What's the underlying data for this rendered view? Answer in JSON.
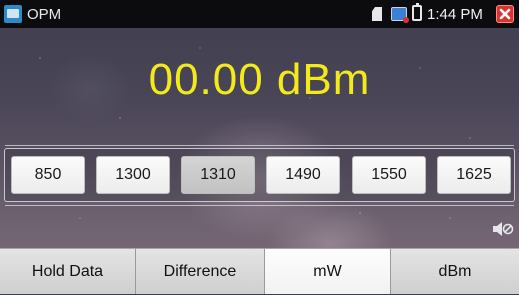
{
  "status_bar": {
    "app_title": "OPM",
    "time": "1:44 PM"
  },
  "reading": {
    "value": "00.00 dBm",
    "color": "#f3ea1b"
  },
  "wavelengths": {
    "items": [
      "850",
      "1300",
      "1310",
      "1490",
      "1550",
      "1625"
    ],
    "selected": "1310"
  },
  "bottom_bar": {
    "hold_label": "Hold Data",
    "difference_label": "Difference",
    "mw_label": "mW",
    "dbm_label": "dBm",
    "active": "mW"
  },
  "icons": {
    "app": "opm-app-icon",
    "sd": "sd-card-icon",
    "tv": "tv-output-icon",
    "battery": "battery-icon",
    "close": "close-icon",
    "sound": "mute-icon"
  }
}
